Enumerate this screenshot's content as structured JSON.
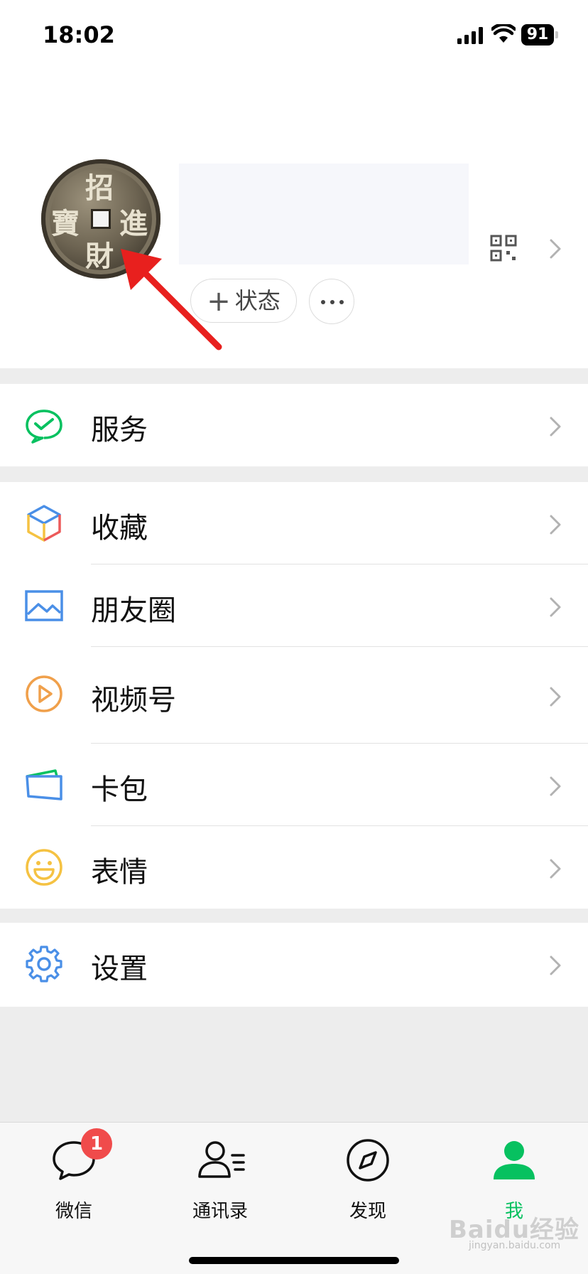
{
  "status_bar": {
    "time": "18:02",
    "battery": "91"
  },
  "profile": {
    "avatar_chars": [
      "招",
      "進",
      "財",
      "寶"
    ],
    "status_button": "状态",
    "add_symbol": "+"
  },
  "menu_groups": [
    {
      "items": [
        {
          "label": "服务",
          "icon": "wechat-pay-icon"
        }
      ]
    },
    {
      "items": [
        {
          "label": "收藏",
          "icon": "favorites-cube-icon"
        },
        {
          "label": "朋友圈",
          "icon": "moments-image-icon"
        },
        {
          "label": "视频号",
          "icon": "channels-play-icon"
        },
        {
          "label": "卡包",
          "icon": "card-wallet-icon"
        },
        {
          "label": "表情",
          "icon": "sticker-smile-icon"
        }
      ]
    },
    {
      "items": [
        {
          "label": "设置",
          "icon": "settings-gear-icon"
        }
      ]
    }
  ],
  "tabbar": {
    "tabs": [
      {
        "label": "微信",
        "icon": "chat-bubble-icon",
        "badge": "1"
      },
      {
        "label": "通讯录",
        "icon": "contacts-icon"
      },
      {
        "label": "发现",
        "icon": "compass-icon"
      },
      {
        "label": "我",
        "icon": "person-icon",
        "active": true
      }
    ]
  },
  "colors": {
    "accent": "#07c160",
    "badge": "#f04b4b",
    "arrow": "#e8201e"
  },
  "watermark": {
    "brand": "Baidu经验",
    "url": "jingyan.baidu.com"
  }
}
